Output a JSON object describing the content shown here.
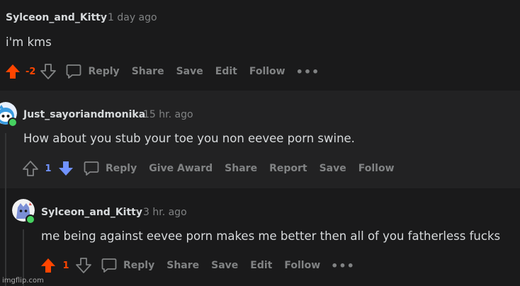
{
  "comments": [
    {
      "author": "Sylceon_and_Kitty",
      "separator": "·",
      "time": "1 day ago",
      "body": "i'm kms",
      "score": "-2",
      "vote_state": "upvoted",
      "actions": [
        "Reply",
        "Share",
        "Save",
        "Edit",
        "Follow"
      ],
      "more": "•••"
    },
    {
      "author": "Just_sayoriandmonika",
      "separator": "·",
      "time": "15 hr. ago",
      "body": "How about you stub your toe you non eevee porn swine.",
      "score": "1",
      "vote_state": "downvoted",
      "actions": [
        "Reply",
        "Give Award",
        "Share",
        "Report",
        "Save",
        "Follow"
      ]
    },
    {
      "author": "Sylceon_and_Kitty",
      "separator": "·",
      "time": "3 hr. ago",
      "body": "me being against eevee porn makes me better then all of you fatherless fucks",
      "score": "1",
      "vote_state": "upvoted",
      "actions": [
        "Reply",
        "Share",
        "Save",
        "Edit",
        "Follow"
      ],
      "more": "•••"
    }
  ],
  "watermark": "imgflip.com",
  "colors": {
    "upvote": "#ff4500",
    "downvote": "#7193ff",
    "muted": "#818384",
    "text": "#d7dadc",
    "online": "#46d160"
  },
  "icons": {
    "upvote": "up-arrow-icon",
    "downvote": "down-arrow-icon",
    "reply": "speech-bubble-icon",
    "more": "ellipsis-icon",
    "online": "online-dot-icon"
  }
}
